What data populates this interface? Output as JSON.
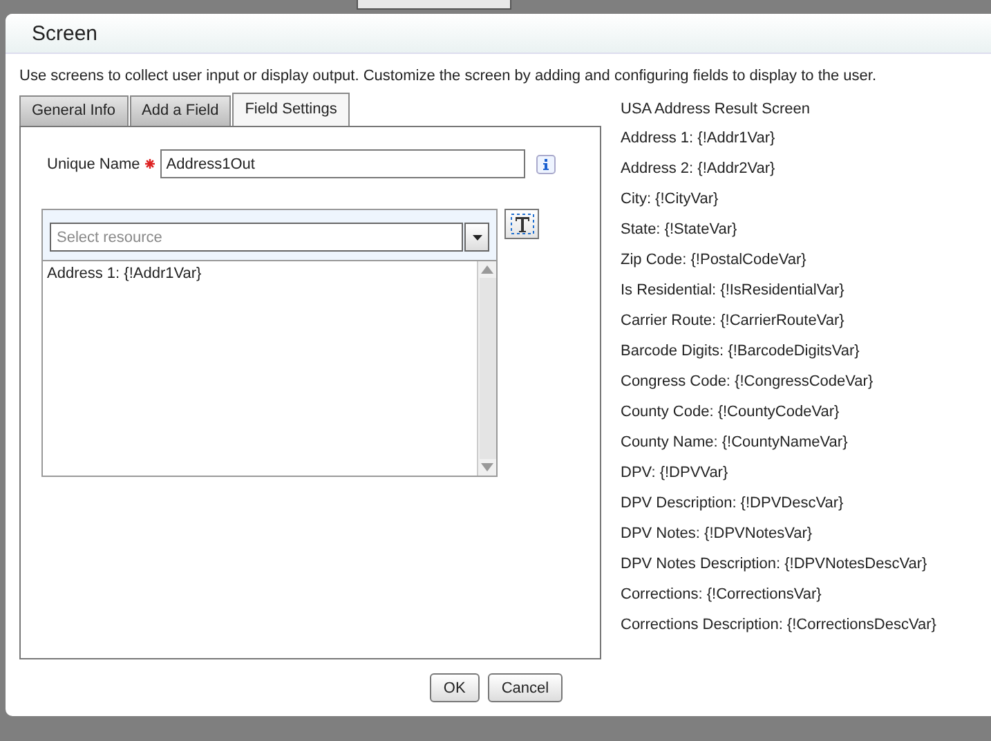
{
  "dialog": {
    "title": "Screen",
    "description": "Use screens to collect user input or display output. Customize the screen by adding and configuring fields to display to the user."
  },
  "tabs": [
    {
      "label": "General Info",
      "selected": false
    },
    {
      "label": "Add a Field",
      "selected": false
    },
    {
      "label": "Field Settings",
      "selected": true
    }
  ],
  "unique_name": {
    "label": "Unique Name",
    "required": true,
    "value": "Address1Out"
  },
  "resource_select": {
    "placeholder": "Select resource"
  },
  "text_area": {
    "value": "Address 1: {!Addr1Var}"
  },
  "preview": {
    "title": "USA Address Result Screen",
    "lines": [
      "Address 1: {!Addr1Var}",
      "Address 2: {!Addr2Var}",
      "City: {!CityVar}",
      "State: {!StateVar}",
      "Zip Code: {!PostalCodeVar}",
      "Is Residential: {!IsResidentialVar}",
      "Carrier Route: {!CarrierRouteVar}",
      "Barcode Digits: {!BarcodeDigitsVar}",
      "Congress Code: {!CongressCodeVar}",
      "County Code: {!CountyCodeVar}",
      "County Name: {!CountyNameVar}",
      "DPV: {!DPVVar}",
      "DPV Description: {!DPVDescVar}",
      "DPV Notes: {!DPVNotesVar}",
      "DPV Notes Description: {!DPVNotesDescVar}",
      "Corrections: {!CorrectionsVar}",
      "Corrections Description: {!CorrectionsDescVar}"
    ]
  },
  "buttons": [
    "OK",
    "Cancel"
  ]
}
